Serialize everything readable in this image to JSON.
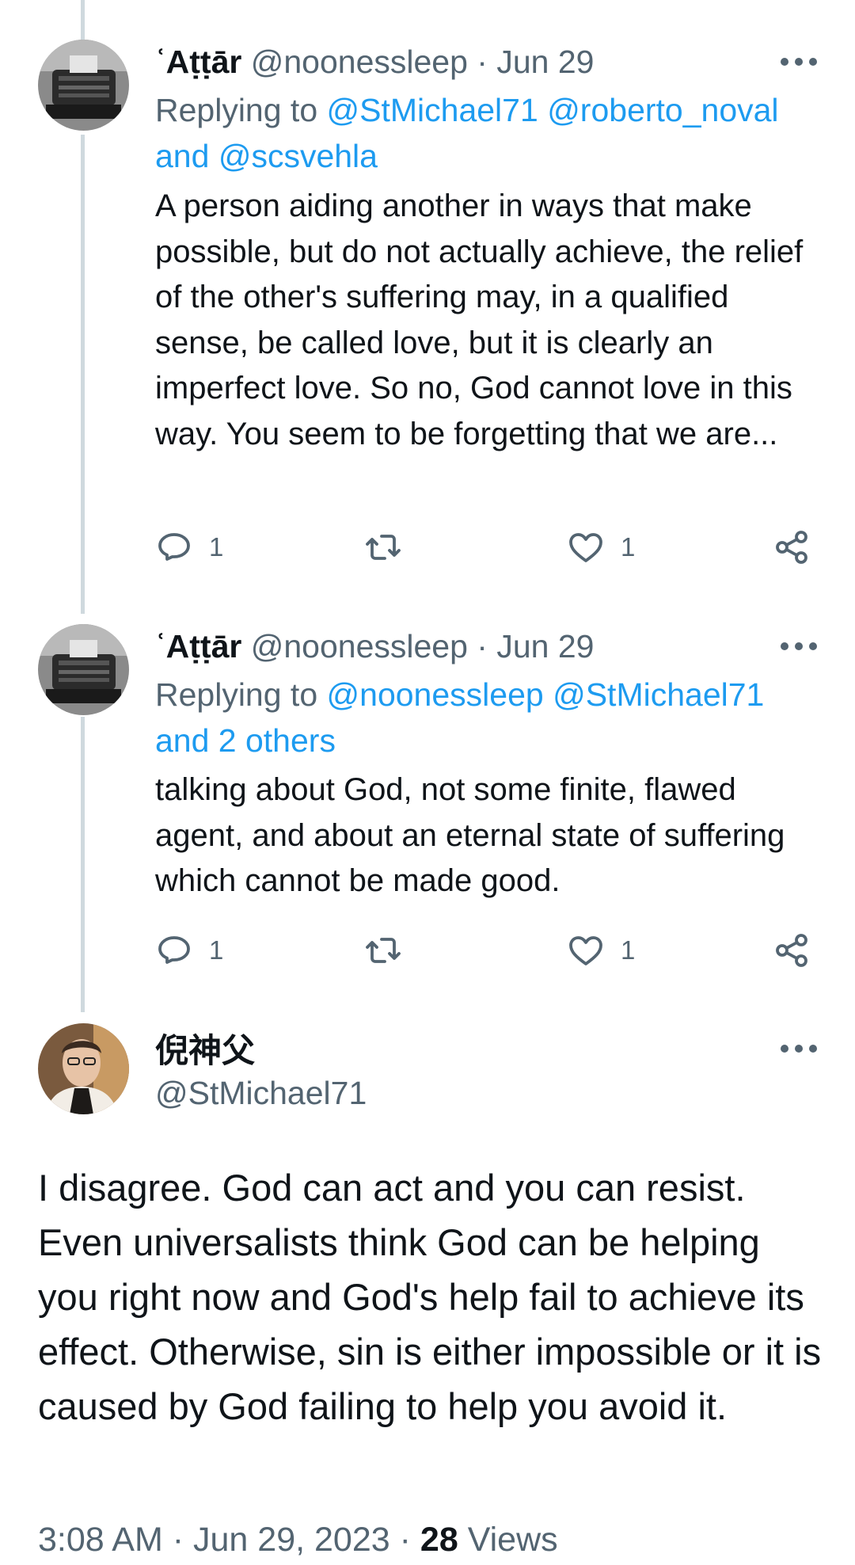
{
  "tweets": [
    {
      "name": "ʿAṭṭār",
      "handle": "@noonessleep",
      "separator": "·",
      "date": "Jun 29",
      "replying_prefix": "Replying to",
      "replying_links": [
        "@StMichael71",
        "@roberto_noval"
      ],
      "replying_and": "and",
      "replying_last": "@scsvehla",
      "text": "A person aiding another in ways that make possible, but do not actually achieve, the relief of the other's suffering may, in a qualified sense, be called love, but it is clearly an imperfect love. So no, God cannot love in this way. You seem to be forgetting that we are...",
      "reply_count": "1",
      "like_count": "1"
    },
    {
      "name": "ʿAṭṭār",
      "handle": "@noonessleep",
      "separator": "·",
      "date": "Jun 29",
      "replying_prefix": "Replying to",
      "replying_links": [
        "@noonessleep",
        "@StMichael71"
      ],
      "replying_others": "and 2 others",
      "text": "talking about God, not some finite, flawed agent, and about an eternal state of suffering which cannot be made good.",
      "reply_count": "1",
      "like_count": "1"
    }
  ],
  "main_tweet": {
    "name": "倪神父",
    "handle": "@StMichael71",
    "text": "I disagree. God can act and you can resist. Even universalists think God can be helping you right now and God's help fail to achieve its effect. Otherwise, sin is either impossible or it is caused by God failing to help you avoid it.",
    "time": "3:08 AM",
    "date": "Jun 29, 2023",
    "views_count": "28",
    "views_label": "Views"
  },
  "icons": {
    "reply": "reply-icon",
    "retweet": "retweet-icon",
    "like": "heart-icon",
    "share": "share-icon",
    "more": "more-options-icon"
  },
  "colors": {
    "link": "#1d9bf0",
    "secondary_text": "#536471",
    "thread_line": "#cfd9de"
  }
}
